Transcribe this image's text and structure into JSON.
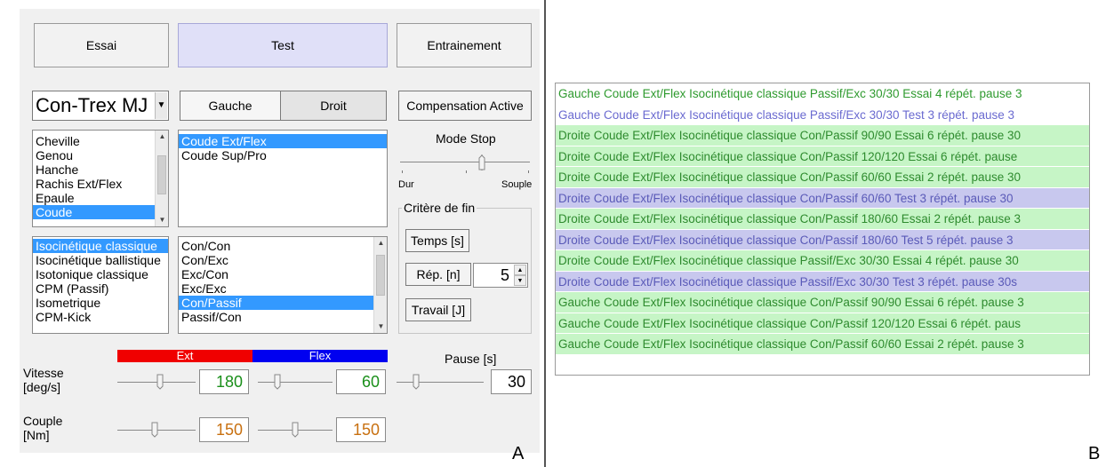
{
  "mode_tabs": [
    {
      "label": "Essai",
      "active": false
    },
    {
      "label": "Test",
      "active": true
    },
    {
      "label": "Entrainement",
      "active": false
    }
  ],
  "device": {
    "selected": "Con-Trex MJ"
  },
  "side": {
    "left_label": "Gauche",
    "right_label": "Droit"
  },
  "compensation_label": "Compensation Active",
  "joints": {
    "items": [
      "Cheville",
      "Genou",
      "Hanche",
      "Rachis Ext/Flex",
      "Epaule",
      "Coude"
    ],
    "selected": "Coude"
  },
  "movements": {
    "items": [
      "Coude Ext/Flex",
      "Coude Sup/Pro"
    ],
    "selected": "Coude Ext/Flex"
  },
  "modes": {
    "items": [
      "Isocinétique classique",
      "Isocinétique ballistique",
      "Isotonique classique",
      "CPM (Passif)",
      "Isometrique",
      "CPM-Kick"
    ],
    "selected": "Isocinétique classique"
  },
  "contraction": {
    "items": [
      "Con/Con",
      "Con/Exc",
      "Exc/Con",
      "Exc/Exc",
      "Con/Passif",
      "Passif/Con"
    ],
    "selected": "Con/Passif"
  },
  "mode_stop": {
    "title": "Mode Stop",
    "left": "Dur",
    "right": "Souple"
  },
  "end_criteria": {
    "title": "Critère de fin",
    "time_button": "Temps [s]",
    "reps_button": "Rép. [n]",
    "reps_value": "5",
    "work_button": "Travail [J]"
  },
  "colors": {
    "ext": "#f00000",
    "flex": "#0000f0",
    "speed_value": "#1a8f1a",
    "torque_value": "#c87010"
  },
  "speed": {
    "label_line1": "Vitesse",
    "label_line2": "[deg/s]",
    "ext_label": "Ext",
    "flex_label": "Flex",
    "ext_value": "180",
    "flex_value": "60"
  },
  "torque": {
    "label_line1": "Couple",
    "label_line2": "[Nm]",
    "ext_value": "150",
    "flex_value": "150"
  },
  "pause": {
    "label": "Pause [s]",
    "value": "30"
  },
  "panel_labels": {
    "a": "A",
    "b": "B"
  },
  "log_rows": [
    {
      "text": "Gauche Coude Ext/Flex Isocinétique classique Passif/Exc 30/30 Essai  4 répét. pause 3",
      "kind": "essai",
      "plain": true
    },
    {
      "text": "Gauche Coude Ext/Flex Isocinétique classique Passif/Exc 30/30 Test  3 répét. pause 3",
      "kind": "test",
      "plain": true
    },
    {
      "text": "Droite Coude Ext/Flex Isocinétique classique Con/Passif 90/90 Essai  6 répét. pause 30",
      "kind": "essai",
      "plain": false
    },
    {
      "text": "Droite Coude Ext/Flex Isocinétique classique Con/Passif 120/120 Essai  6 répét. pause",
      "kind": "essai",
      "plain": false
    },
    {
      "text": "Droite Coude Ext/Flex Isocinétique classique Con/Passif 60/60 Essai  2 répét. pause 30",
      "kind": "essai",
      "plain": false
    },
    {
      "text": "Droite Coude Ext/Flex Isocinétique classique Con/Passif 60/60 Test  3 répét. pause 30",
      "kind": "test",
      "plain": false
    },
    {
      "text": "Droite Coude Ext/Flex Isocinétique classique Con/Passif 180/60 Essai  2 répét. pause 3",
      "kind": "essai",
      "plain": false
    },
    {
      "text": "Droite Coude Ext/Flex Isocinétique classique Con/Passif 180/60 Test  5 répét. pause 3",
      "kind": "test",
      "plain": false
    },
    {
      "text": "Droite Coude Ext/Flex Isocinétique classique Passif/Exc 30/30 Essai  4 répét. pause 30",
      "kind": "essai",
      "plain": false
    },
    {
      "text": "Droite Coude Ext/Flex Isocinétique classique Passif/Exc 30/30 Test  3 répét. pause 30s",
      "kind": "test",
      "plain": false
    },
    {
      "text": "Gauche Coude Ext/Flex Isocinétique classique Con/Passif 90/90 Essai  6 répét. pause 3",
      "kind": "essai",
      "plain": false
    },
    {
      "text": "Gauche Coude Ext/Flex Isocinétique classique Con/Passif 120/120 Essai  6 répét. paus",
      "kind": "essai",
      "plain": false
    },
    {
      "text": "Gauche Coude Ext/Flex Isocinétique classique Con/Passif 60/60 Essai  2 répét. pause 3",
      "kind": "essai",
      "plain": false
    }
  ]
}
